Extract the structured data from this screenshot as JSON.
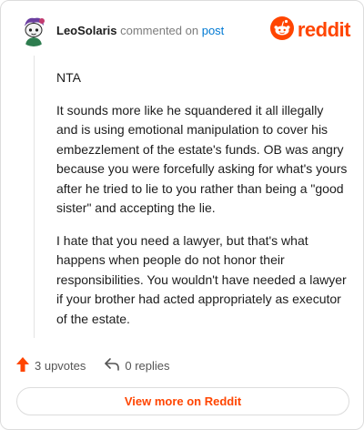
{
  "header": {
    "username": "LeoSolaris",
    "verb": "commented on",
    "post_link": "post",
    "brand": "reddit"
  },
  "comment": {
    "paragraphs": [
      "NTA",
      "It sounds more like he squandered it all illegally and is using emotional manipulation to cover his embezzlement of the estate's funds. OB was angry because you were forcefully asking for what's yours after he tried to lie to you rather than being a \"good sister\" and accepting the lie.",
      "I hate that you need a lawyer, but that's what happens when people do not honor their responsibilities. You wouldn't have needed a lawyer if your brother had acted appropriately as executor of the estate."
    ]
  },
  "actions": {
    "upvotes": "3 upvotes",
    "replies": "0 replies"
  },
  "view_more": "View more on Reddit",
  "icons": {
    "avatar": "avatar-icon",
    "brand": "reddit-logo-icon",
    "upvote": "upvote-arrow-icon",
    "reply": "reply-arrow-icon"
  },
  "colors": {
    "brand": "#ff4500",
    "link": "#0079d3",
    "muted": "#7c7c7c"
  }
}
